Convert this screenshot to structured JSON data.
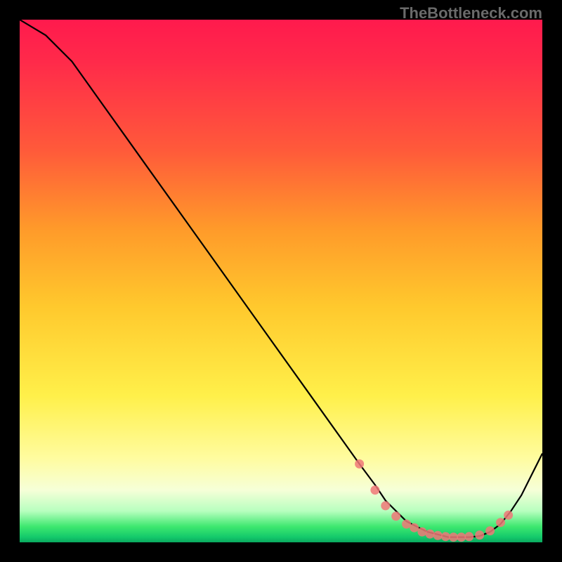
{
  "watermark": "TheBottleneck.com",
  "chart_data": {
    "type": "line",
    "title": "",
    "xlabel": "",
    "ylabel": "",
    "xlim": [
      0,
      100
    ],
    "ylim": [
      0,
      100
    ],
    "grid": false,
    "legend": false,
    "series": [
      {
        "name": "curve",
        "x": [
          0,
          5,
          10,
          15,
          20,
          25,
          30,
          35,
          40,
          45,
          50,
          55,
          60,
          65,
          68,
          70,
          72,
          74,
          76,
          78,
          80,
          82,
          84,
          86,
          88,
          90,
          92,
          94,
          96,
          98,
          100
        ],
        "y": [
          100,
          97,
          92,
          85,
          78,
          71,
          64,
          57,
          50,
          43,
          36,
          29,
          22,
          15,
          11,
          8,
          6,
          4,
          3,
          2,
          1.5,
          1,
          1,
          1,
          1.2,
          2,
          3.5,
          6,
          9,
          13,
          17
        ]
      }
    ],
    "dots": {
      "name": "bottleneck-markers",
      "points": [
        {
          "x": 65,
          "y": 15
        },
        {
          "x": 68,
          "y": 10
        },
        {
          "x": 70,
          "y": 7
        },
        {
          "x": 72,
          "y": 5
        },
        {
          "x": 74,
          "y": 3.5
        },
        {
          "x": 75.5,
          "y": 2.8
        },
        {
          "x": 77,
          "y": 2
        },
        {
          "x": 78.5,
          "y": 1.6
        },
        {
          "x": 80,
          "y": 1.3
        },
        {
          "x": 81.5,
          "y": 1.1
        },
        {
          "x": 83,
          "y": 1
        },
        {
          "x": 84.5,
          "y": 1
        },
        {
          "x": 86,
          "y": 1.1
        },
        {
          "x": 88,
          "y": 1.4
        },
        {
          "x": 90,
          "y": 2.2
        },
        {
          "x": 92,
          "y": 3.8
        },
        {
          "x": 93.5,
          "y": 5.2
        }
      ]
    }
  }
}
